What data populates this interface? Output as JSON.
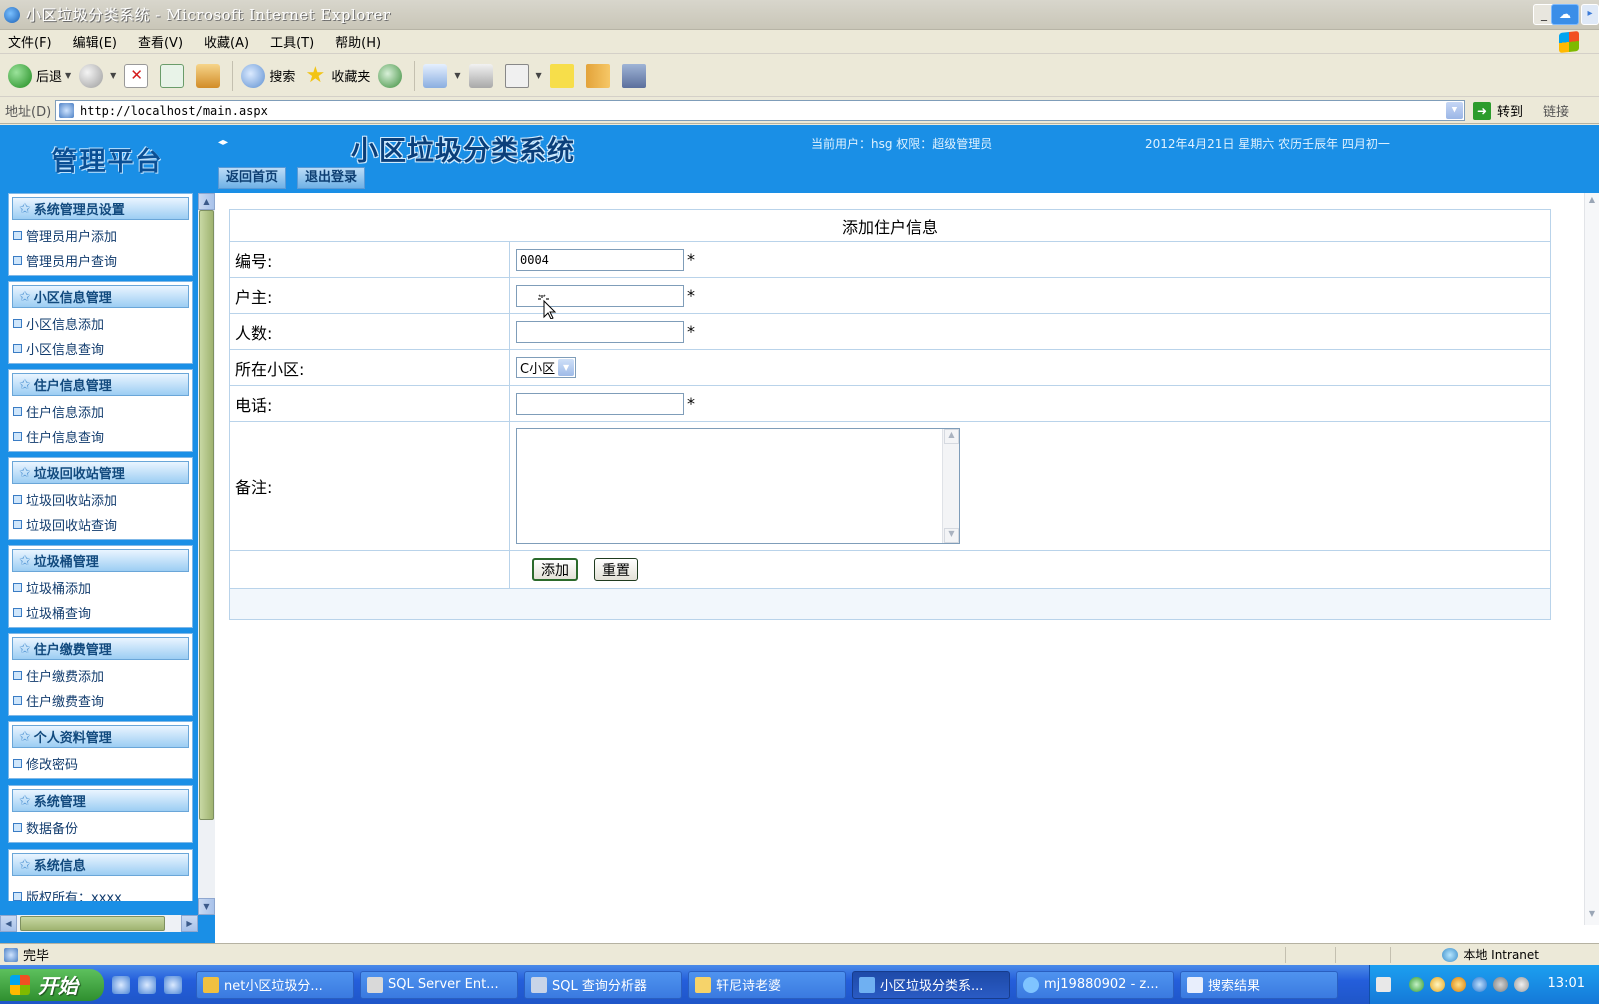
{
  "window": {
    "title": "小区垃圾分类系统 - Microsoft Internet Explorer"
  },
  "menubar": [
    "文件(F)",
    "编辑(E)",
    "查看(V)",
    "收藏(A)",
    "工具(T)",
    "帮助(H)"
  ],
  "toolbar": {
    "back_label": "后退",
    "search_label": "搜索",
    "favorites_label": "收藏夹"
  },
  "address": {
    "label": "地址(D)",
    "url": "http://localhost/main.aspx",
    "go_label": "转到",
    "links_label": "链接"
  },
  "sidebar": {
    "title": "管理平台",
    "groups": [
      {
        "title": "系统管理员设置",
        "items": [
          "管理员用户添加",
          "管理员用户查询"
        ]
      },
      {
        "title": "小区信息管理",
        "items": [
          "小区信息添加",
          "小区信息查询"
        ]
      },
      {
        "title": "住户信息管理",
        "items": [
          "住户信息添加",
          "住户信息查询"
        ]
      },
      {
        "title": "垃圾回收站管理",
        "items": [
          "垃圾回收站添加",
          "垃圾回收站查询"
        ]
      },
      {
        "title": "垃圾桶管理",
        "items": [
          "垃圾桶添加",
          "垃圾桶查询"
        ]
      },
      {
        "title": "住户缴费管理",
        "items": [
          "住户缴费添加",
          "住户缴费查询"
        ]
      },
      {
        "title": "个人资料管理",
        "items": [
          "修改密码"
        ]
      },
      {
        "title": "系统管理",
        "items": [
          "数据备份"
        ]
      },
      {
        "title": "系统信息",
        "items": [
          "版权所有：xxxx"
        ]
      }
    ]
  },
  "header": {
    "system_title": "小区垃圾分类系统",
    "user_info": "当前用户：hsg  权限：超级管理员",
    "date_info": "2012年4月21日  星期六  农历壬辰年  四月初一",
    "nav_home": "返回首页",
    "nav_logout": "退出登录"
  },
  "form": {
    "caption": "添加住户信息",
    "fields": {
      "id_label": "编号:",
      "id_value": "0004",
      "owner_label": "户主:",
      "owner_value": "",
      "count_label": "人数:",
      "count_value": "",
      "community_label": "所在小区:",
      "community_value": "C小区",
      "phone_label": "电话:",
      "phone_value": "",
      "remark_label": "备注:",
      "remark_value": ""
    },
    "required_mark": "*",
    "add_button": "添加",
    "reset_button": "重置"
  },
  "statusbar": {
    "status_text": "完毕",
    "zone_text": "本地 Intranet"
  },
  "taskbar": {
    "start_label": "开始",
    "tasks": [
      "net小区垃圾分...",
      "SQL Server Ent...",
      "SQL 查询分析器",
      "轩尼诗老婆",
      "小区垃圾分类系...",
      "mj19880902 - z...",
      "搜索结果"
    ],
    "clock": "13:01"
  }
}
